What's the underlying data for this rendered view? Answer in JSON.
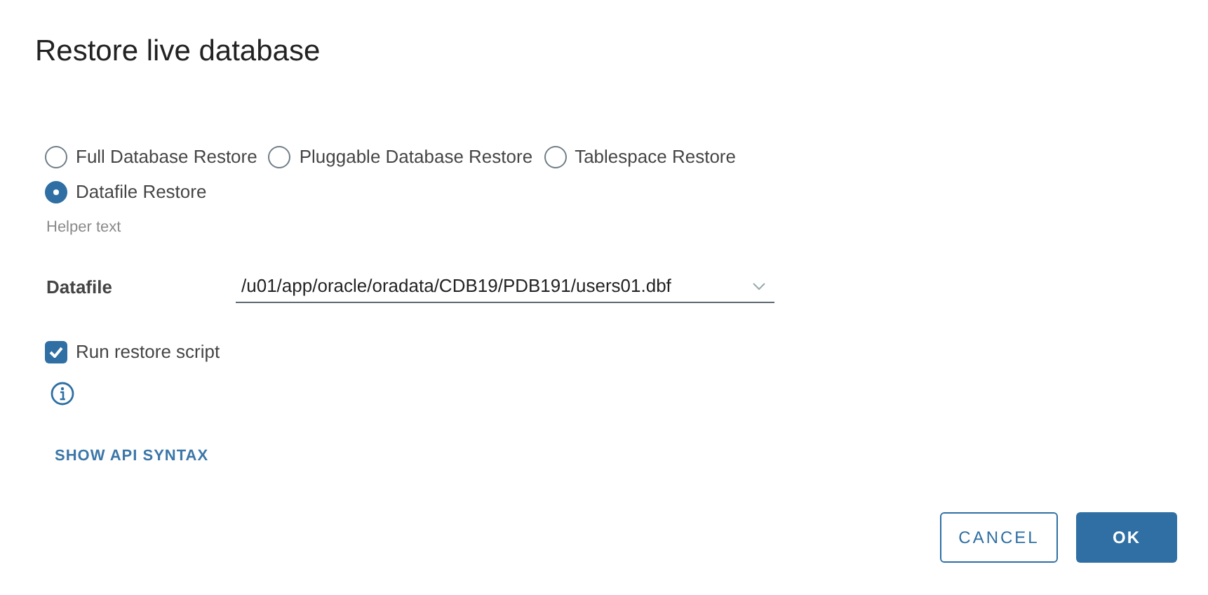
{
  "dialog": {
    "title": "Restore live database"
  },
  "restore_types": [
    {
      "label": "Full Database Restore",
      "selected": false
    },
    {
      "label": "Pluggable Database Restore",
      "selected": false
    },
    {
      "label": "Tablespace Restore",
      "selected": false
    },
    {
      "label": "Datafile Restore",
      "selected": true
    }
  ],
  "helper_text": "Helper text",
  "datafile": {
    "label": "Datafile",
    "value": "/u01/app/oracle/oradata/CDB19/PDB191/users01.dbf"
  },
  "run_restore_script": {
    "label": "Run restore script",
    "checked": true
  },
  "api_link": "SHOW API SYNTAX",
  "buttons": [
    {
      "label": "CANCEL",
      "kind": "secondary"
    },
    {
      "label": "OK",
      "kind": "primary"
    }
  ]
}
